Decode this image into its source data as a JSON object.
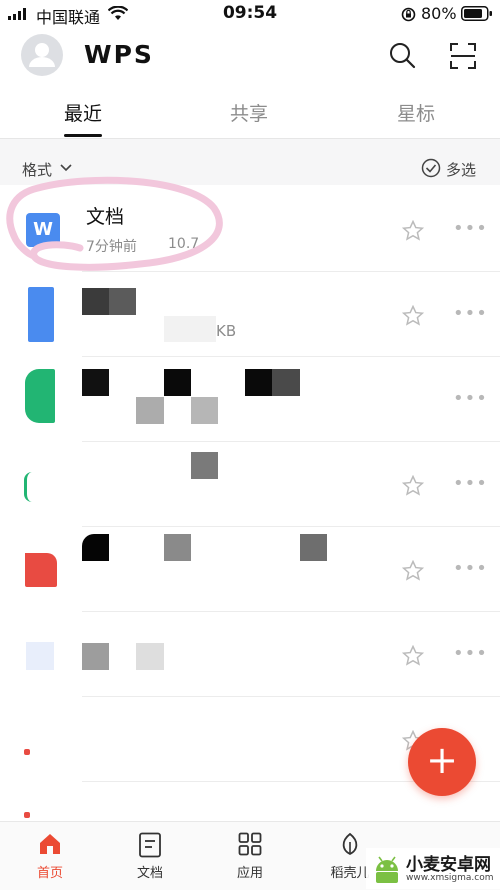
{
  "status_bar": {
    "carrier": "中国联通",
    "time": "09:54",
    "battery": "80%"
  },
  "header": {
    "logo": "WPS",
    "icons": [
      "avatar-icon",
      "search-icon",
      "scan-icon"
    ]
  },
  "tabs": [
    {
      "label": "最近",
      "active": true
    },
    {
      "label": "共享",
      "active": false
    },
    {
      "label": "星标",
      "active": false
    }
  ],
  "toolbar": {
    "format_label": "格式",
    "multi_select_label": "多选"
  },
  "files": [
    {
      "title": "文档",
      "time": "7分钟前",
      "size": "10.7",
      "icon_letter": "W",
      "icon_color": "#4a8bef"
    },
    {
      "size_fragment": "KB",
      "icon_color": "#4a8bef"
    },
    {
      "icon_color": "#22b573"
    },
    {
      "icon_color": "#22b573"
    },
    {
      "icon_color": "#e84b42"
    },
    {
      "icon_color": "#e8eefb"
    },
    {
      "icon_color": "#e84b42"
    }
  ],
  "fab": {
    "label": "+"
  },
  "bottom_nav": [
    {
      "label": "首页",
      "icon": "home-icon",
      "active": true
    },
    {
      "label": "文档",
      "icon": "document-icon",
      "active": false
    },
    {
      "label": "应用",
      "icon": "apps-icon",
      "active": false
    },
    {
      "label": "稻壳儿",
      "icon": "leaf-icon",
      "active": false
    }
  ],
  "watermark": {
    "name": "小麦安卓网",
    "url": "www.xmsigma.com"
  },
  "colors": {
    "accent": "#eb4a33",
    "wps_blue": "#4a8bef",
    "annotation_pink": "#f2c7dc"
  }
}
